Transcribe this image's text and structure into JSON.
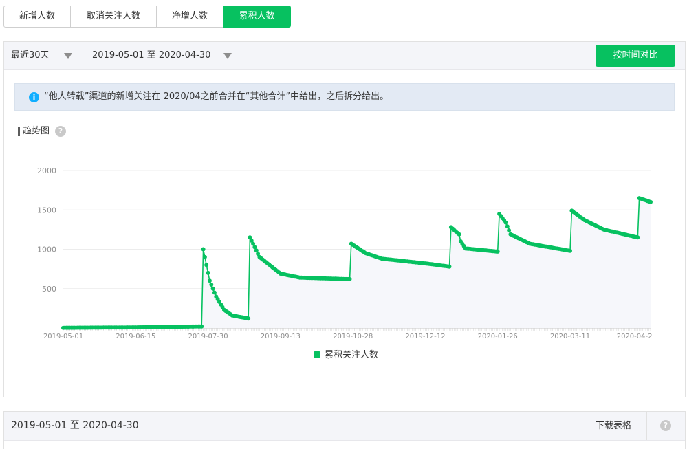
{
  "tabs": [
    {
      "label": "新增人数",
      "active": false
    },
    {
      "label": "取消关注人数",
      "active": false
    },
    {
      "label": "净增人数",
      "active": false
    },
    {
      "label": "累积人数",
      "active": true
    }
  ],
  "filters": {
    "period": "最近30天",
    "date_range": "2019-05-01 至 2020-04-30",
    "compare_button": "按时间对比"
  },
  "notice": {
    "icon": "info-icon",
    "text": "“他人转载”渠道的新增关注在 2020/04之前合并在“其他合计”中给出，之后拆分给出。"
  },
  "trend": {
    "title": "趋势图",
    "help_icon": "question-icon"
  },
  "colors": {
    "accent": "#07c160",
    "series": "#07c160",
    "info": "#10aeff"
  },
  "chart_data": {
    "type": "line",
    "ylim": [
      0,
      2000
    ],
    "yticks": [
      500,
      1000,
      1500,
      2000
    ],
    "x_range": [
      "2019-05-01",
      "2020-04-30"
    ],
    "xtick_labels": [
      "2019-05-01",
      "2019-06-15",
      "2019-07-30",
      "2019-09-13",
      "2019-10-28",
      "2019-12-12",
      "2020-01-26",
      "2020-03-11",
      "2020-04-2"
    ],
    "legend_position": "bottom",
    "series": [
      {
        "name": "累积关注人数",
        "color": "#07c160",
        "points": [
          [
            "2019-05-01",
            3
          ],
          [
            "2019-06-15",
            8
          ],
          [
            "2019-07-26",
            20
          ],
          [
            "2019-07-27",
            1000
          ],
          [
            "2019-07-29",
            800
          ],
          [
            "2019-07-31",
            600
          ],
          [
            "2019-08-04",
            400
          ],
          [
            "2019-08-09",
            230
          ],
          [
            "2019-08-14",
            160
          ],
          [
            "2019-08-24",
            120
          ],
          [
            "2019-08-25",
            1150
          ],
          [
            "2019-08-27",
            1070
          ],
          [
            "2019-08-31",
            900
          ],
          [
            "2019-09-13",
            690
          ],
          [
            "2019-09-25",
            640
          ],
          [
            "2019-10-26",
            620
          ],
          [
            "2019-10-27",
            1070
          ],
          [
            "2019-11-05",
            950
          ],
          [
            "2019-11-15",
            880
          ],
          [
            "2019-12-12",
            820
          ],
          [
            "2019-12-27",
            780
          ],
          [
            "2019-12-28",
            1280
          ],
          [
            "2020-01-02",
            1190
          ],
          [
            "2020-01-03",
            1100
          ],
          [
            "2020-01-06",
            1010
          ],
          [
            "2020-01-26",
            970
          ],
          [
            "2020-01-27",
            1450
          ],
          [
            "2020-01-31",
            1340
          ],
          [
            "2020-02-03",
            1190
          ],
          [
            "2020-02-15",
            1070
          ],
          [
            "2020-03-11",
            980
          ],
          [
            "2020-03-12",
            1490
          ],
          [
            "2020-03-20",
            1370
          ],
          [
            "2020-04-01",
            1250
          ],
          [
            "2020-04-22",
            1150
          ],
          [
            "2020-04-23",
            1650
          ],
          [
            "2020-04-30",
            1600
          ]
        ]
      }
    ]
  },
  "table_header": {
    "date_range": "2019-05-01 至 2020-04-30",
    "download": "下载表格",
    "help_icon": "question-icon"
  }
}
